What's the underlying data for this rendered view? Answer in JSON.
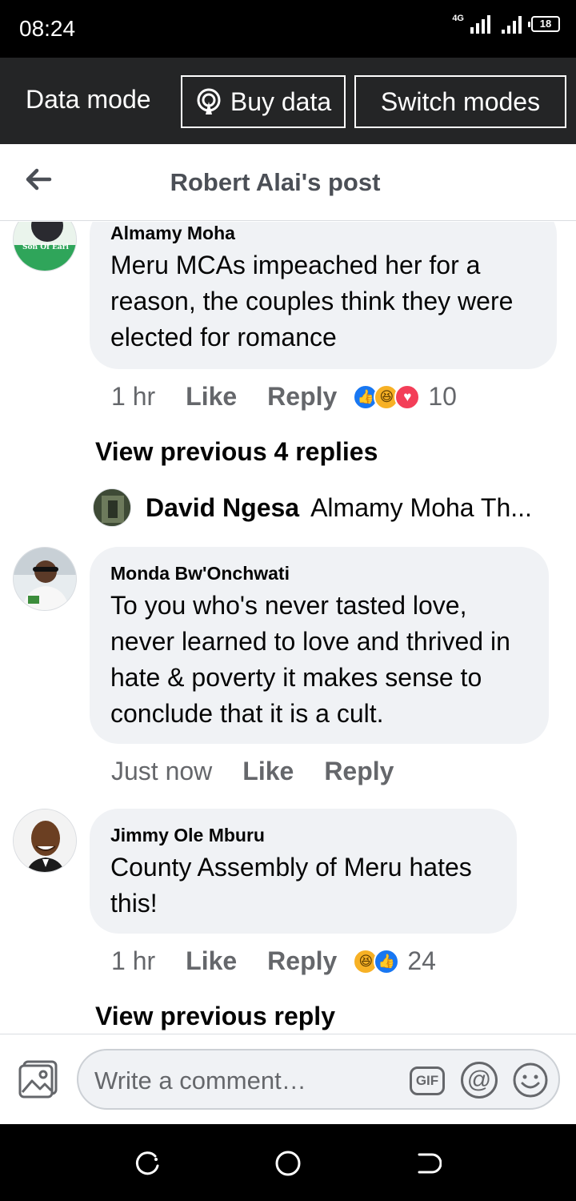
{
  "status_bar": {
    "time": "08:24",
    "network": "4G",
    "battery": "18"
  },
  "data_bar": {
    "label": "Data mode",
    "buy_label": "Buy data",
    "switch_label": "Switch modes"
  },
  "header": {
    "title": "Robert Alai's post"
  },
  "comments": [
    {
      "name": "Almamy Moha",
      "lines": [
        "Meru MCAs impeached her for a",
        "reason, the couples think they were",
        "elected for romance"
      ],
      "time": "1 hr",
      "like": "Like",
      "reply": "Reply",
      "reactions": [
        "like",
        "haha",
        "love"
      ],
      "reaction_count": "10"
    },
    {
      "name": "Monda Bw'Onchwati",
      "lines": [
        "To you who's never tasted love,",
        "never learned to love and thrived in",
        "hate & poverty it makes sense to",
        "conclude that it is a cult."
      ],
      "time": "Just now",
      "like": "Like",
      "reply": "Reply"
    },
    {
      "name": "Jimmy Ole Mburu",
      "lines": [
        "County Assembly of Meru hates",
        "this!"
      ],
      "time": "1 hr",
      "like": "Like",
      "reply": "Reply",
      "reactions": [
        "haha",
        "like"
      ],
      "reaction_count": "24"
    }
  ],
  "thread_1": {
    "view_previous": "View previous 4 replies",
    "reply_preview": {
      "name": "David Ngesa",
      "text": "Almamy Moha Th..."
    }
  },
  "thread_3": {
    "view_previous": "View previous reply"
  },
  "avatar_badges": {
    "almamy": "Son Of Earl"
  },
  "composer": {
    "placeholder": "Write a comment…",
    "gif": "GIF",
    "at": "@"
  },
  "colors": {
    "bubble": "#f0f2f5",
    "secondary_text": "#65676b",
    "data_bar": "#242526",
    "like_blue": "#1877f2"
  }
}
